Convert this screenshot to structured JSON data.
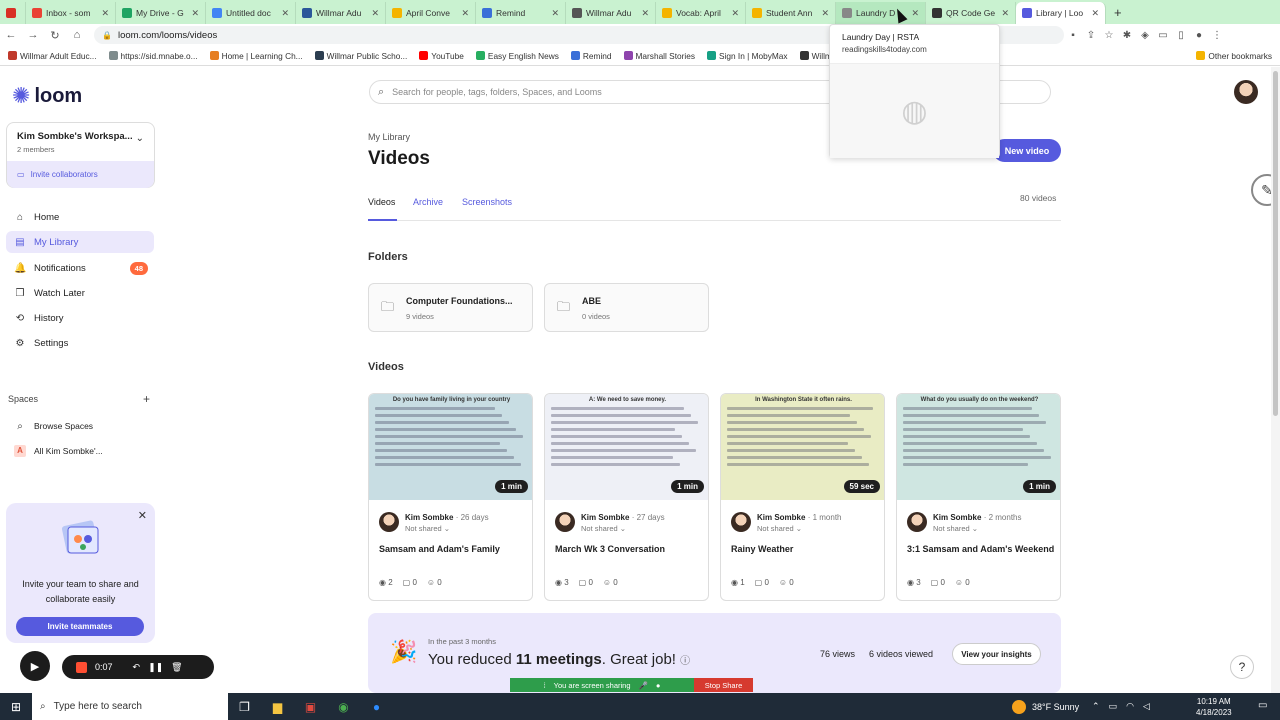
{
  "browser": {
    "tabs": [
      {
        "label": "",
        "color": "#d93025"
      },
      {
        "label": "Inbox - som",
        "color": "#ea4335"
      },
      {
        "label": "My Drive - G",
        "color": "#1fa463"
      },
      {
        "label": "Untitled doc",
        "color": "#4285f4"
      },
      {
        "label": "Willmar Adu",
        "color": "#2b579a"
      },
      {
        "label": "April Conve",
        "color": "#f4b400"
      },
      {
        "label": "Remind",
        "color": "#3a6fd8"
      },
      {
        "label": "Willmar Adu",
        "color": "#555555"
      },
      {
        "label": "Vocab: April",
        "color": "#f4b400"
      },
      {
        "label": "Student Ann",
        "color": "#f4b400"
      },
      {
        "label": "Laundry D",
        "color": "#888888"
      },
      {
        "label": "QR Code Ge",
        "color": "#333333"
      },
      {
        "label": "Library | Loo",
        "color": "#565ade"
      }
    ],
    "new_tab": "+",
    "url": "loom.com/looms/videos",
    "bookmarks": [
      {
        "label": "Willmar Adult Educ...",
        "color": "#c0392b"
      },
      {
        "label": "https://sid.mnabe.o...",
        "color": "#7f8c8d"
      },
      {
        "label": "Home | Learning Ch...",
        "color": "#e67e22"
      },
      {
        "label": "Willmar Public Scho...",
        "color": "#2c3e50"
      },
      {
        "label": "YouTube",
        "color": "#ff0000"
      },
      {
        "label": "Easy English News",
        "color": "#27ae60"
      },
      {
        "label": "Remind",
        "color": "#3a6fd8"
      },
      {
        "label": "Marshall Stories",
        "color": "#8e44ad"
      },
      {
        "label": "Sign In | MobyMax",
        "color": "#16a085"
      },
      {
        "label": "Willm",
        "color": "#333333"
      },
      {
        "label": "ver's",
        "color": "#555555"
      },
      {
        "label": "Remind",
        "color": "#3a6fd8"
      },
      {
        "label": "Typing.com",
        "color": "#2980b9"
      },
      {
        "label": "Other bookmarks",
        "color": "#f4b400"
      }
    ],
    "tooltip": {
      "title": "Laundry Day | RSTA",
      "url": "readingskills4today.com"
    }
  },
  "sidebar": {
    "logo": "loom",
    "workspace_name": "Kim Sombke's Workspa...",
    "workspace_members": "2 members",
    "invite_collaborators": "Invite collaborators",
    "nav": [
      {
        "label": "Home",
        "icon": "home-icon",
        "glyph": "⌂"
      },
      {
        "label": "My Library",
        "icon": "library-icon",
        "glyph": "▤"
      },
      {
        "label": "Notifications",
        "icon": "bell-icon",
        "glyph": "🔔",
        "badge": "48"
      },
      {
        "label": "Watch Later",
        "icon": "bookmark-icon",
        "glyph": "❒"
      },
      {
        "label": "History",
        "icon": "history-icon",
        "glyph": "⟲"
      },
      {
        "label": "Settings",
        "icon": "gear-icon",
        "glyph": "⚙"
      }
    ],
    "spaces_label": "Spaces",
    "spaces_add": "+",
    "spaces": [
      {
        "label": "Browse Spaces",
        "glyph": "⌕"
      },
      {
        "label": "All Kim Sombke'...",
        "glyph": "A"
      }
    ],
    "invite_card": {
      "text": "Invite your team to share and collaborate easily",
      "button": "Invite teammates"
    }
  },
  "recorder": {
    "time": "0:07"
  },
  "main": {
    "search_placeholder": "Search for people, tags, folders, Spaces, and Looms",
    "breadcrumb": "My Library",
    "title": "Videos",
    "new_video": "New video",
    "tabs": [
      "Videos",
      "Archive",
      "Screenshots"
    ],
    "video_count": "80 videos",
    "folders_title": "Folders",
    "folders": [
      {
        "name": "Computer Foundations...",
        "count": "9 videos"
      },
      {
        "name": "ABE",
        "count": "0 videos"
      }
    ],
    "videos_title": "Videos",
    "videos": [
      {
        "author": "Kim Sombke",
        "time": "26 days",
        "shared": "Not shared",
        "title": "Samsam and Adam's Family",
        "duration": "1 min",
        "views": "2",
        "comments": "0",
        "reactions": "0",
        "thumb_title": "Do you have family living in your country",
        "thumb_color": "#c8dde3"
      },
      {
        "author": "Kim Sombke",
        "time": "27 days",
        "shared": "Not shared",
        "title": "March Wk 3 Conversation",
        "duration": "1 min",
        "views": "3",
        "comments": "0",
        "reactions": "0",
        "thumb_title": "A: We need to save money.",
        "thumb_color": "#eef0f6"
      },
      {
        "author": "Kim Sombke",
        "time": "1 month",
        "shared": "Not shared",
        "title": "Rainy Weather",
        "duration": "59 sec",
        "views": "1",
        "comments": "0",
        "reactions": "0",
        "thumb_title": "In Washington State it often rains.",
        "thumb_color": "#e9ecc4"
      },
      {
        "author": "Kim Sombke",
        "time": "2 months",
        "shared": "Not shared",
        "title": "3:1 Samsam and Adam's Weekend",
        "duration": "1 min",
        "views": "3",
        "comments": "0",
        "reactions": "0",
        "thumb_title": "What do you usually do on the weekend?",
        "thumb_color": "#cfe6e1"
      }
    ],
    "insights": {
      "sub": "In the past 3 months",
      "prefix": "You reduced ",
      "count": "11 meetings",
      "suffix": ". Great job!",
      "views": "76 views",
      "viewed": "6 videos viewed",
      "button": "View your insights"
    },
    "sharing": "You are screen sharing",
    "stop_share": "Stop Share"
  },
  "taskbar": {
    "search_placeholder": "Type here to search",
    "weather": "38°F  Sunny",
    "time": "10:19 AM",
    "date": "4/18/2023"
  }
}
